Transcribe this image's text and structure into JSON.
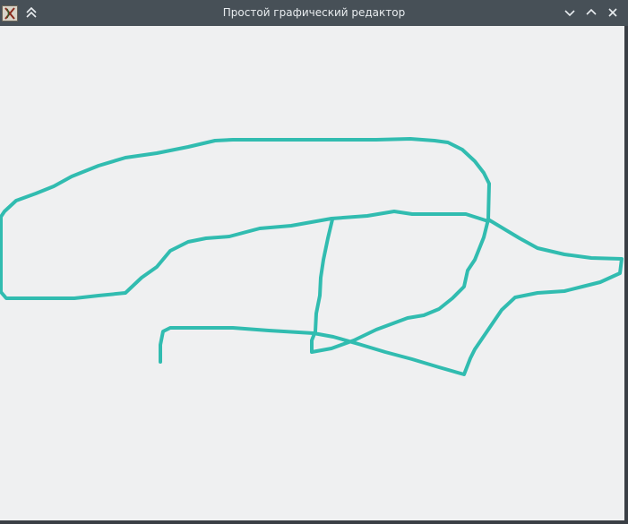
{
  "window": {
    "title": "Простой графический редактор",
    "buttons": {
      "keep_above": "keep-above",
      "minimize": "minimize",
      "maximize": "maximize",
      "close": "close"
    }
  },
  "canvas": {
    "background": "#eff0f1",
    "stroke_color": "#31bcb0"
  }
}
